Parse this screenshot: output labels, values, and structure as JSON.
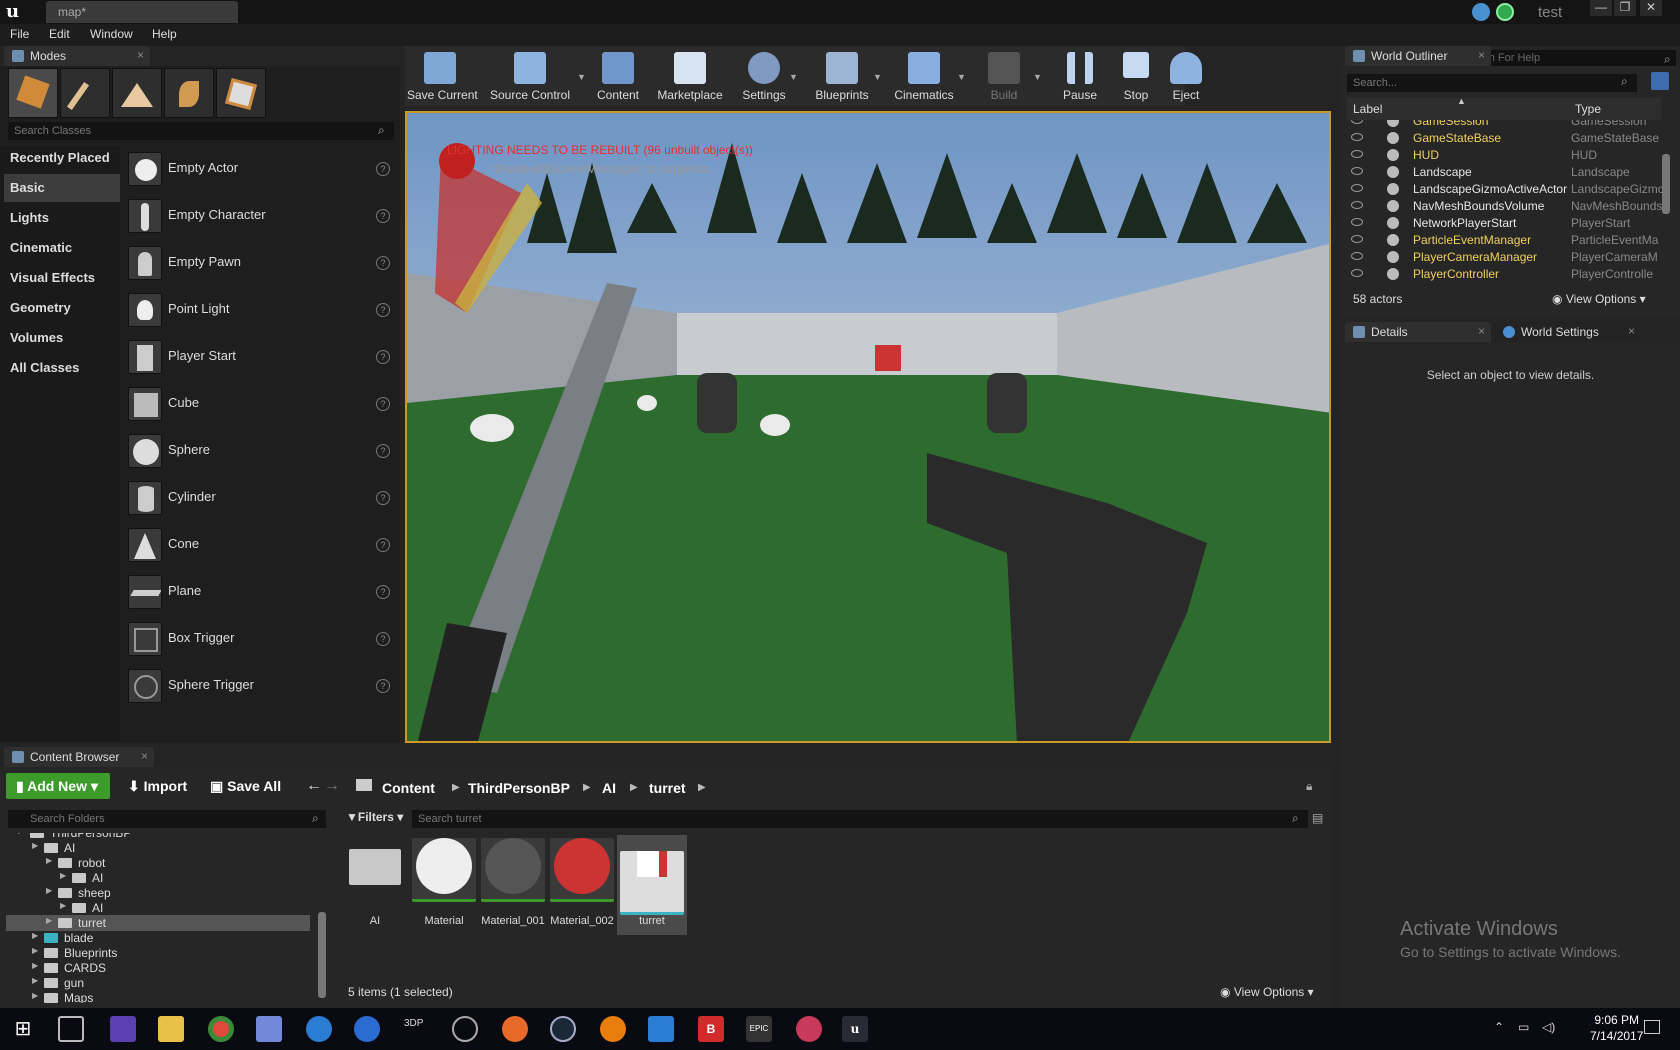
{
  "titlebar": {
    "tab_title": "map*",
    "project_name": "test"
  },
  "menu": {
    "items": [
      "File",
      "Edit",
      "Window",
      "Help"
    ],
    "search_placeholder": "Search For Help"
  },
  "modes": {
    "tab_label": "Modes",
    "search_placeholder": "Search Classes",
    "categories": [
      "Recently Placed",
      "Basic",
      "Lights",
      "Cinematic",
      "Visual Effects",
      "Geometry",
      "Volumes",
      "All Classes"
    ],
    "selected_category": "Basic",
    "items": [
      "Empty Actor",
      "Empty Character",
      "Empty Pawn",
      "Point Light",
      "Player Start",
      "Cube",
      "Sphere",
      "Cylinder",
      "Cone",
      "Plane",
      "Box Trigger",
      "Sphere Trigger"
    ]
  },
  "toolbar": {
    "buttons": [
      "Save Current",
      "Source Control",
      "Content",
      "Marketplace",
      "Settings",
      "Blueprints",
      "Cinematics",
      "Build",
      "Pause",
      "Stop",
      "Eject"
    ],
    "disabled": [
      "Build"
    ]
  },
  "viewport": {
    "warning": "LIGHTING NEEDS TO BE REBUILT (96 unbuilt object(s))",
    "hint": "'DisableAllScreenMessages' to suppress"
  },
  "outliner": {
    "tab_label": "World Outliner",
    "search_placeholder": "Search...",
    "col_label": "Label",
    "col_type": "Type",
    "rows": [
      {
        "label": "GameSession",
        "type": "GameSession",
        "color": "yellow"
      },
      {
        "label": "GameStateBase",
        "type": "GameStateBase",
        "color": "yellow"
      },
      {
        "label": "HUD",
        "type": "HUD",
        "color": "yellow"
      },
      {
        "label": "Landscape",
        "type": "Landscape",
        "color": "white"
      },
      {
        "label": "LandscapeGizmoActiveActor",
        "type": "LandscapeGizmo",
        "color": "white"
      },
      {
        "label": "NavMeshBoundsVolume",
        "type": "NavMeshBounds",
        "color": "white"
      },
      {
        "label": "NetworkPlayerStart",
        "type": "PlayerStart",
        "color": "white"
      },
      {
        "label": "ParticleEventManager",
        "type": "ParticleEventMa",
        "color": "yellow"
      },
      {
        "label": "PlayerCameraManager",
        "type": "PlayerCameraM",
        "color": "yellow"
      },
      {
        "label": "PlayerController",
        "type": "PlayerControlle",
        "color": "yellow"
      }
    ],
    "actor_count": "58 actors",
    "view_options": "View Options"
  },
  "details": {
    "tab_details": "Details",
    "tab_world_settings": "World Settings",
    "empty_message": "Select an object to view details."
  },
  "content_browser": {
    "tab_label": "Content Browser",
    "add_new": "Add New",
    "import": "Import",
    "save_all": "Save All",
    "breadcrumbs": [
      "Content",
      "ThirdPersonBP",
      "AI",
      "turret"
    ],
    "folder_search_placeholder": "Search Folders",
    "filters": "Filters",
    "asset_search_placeholder": "Search turret",
    "tree": [
      {
        "label": "ThirdPersonBP",
        "indent": 1,
        "teal": false
      },
      {
        "label": "AI",
        "indent": 2,
        "teal": false
      },
      {
        "label": "robot",
        "indent": 3,
        "teal": false
      },
      {
        "label": "AI",
        "indent": 4,
        "teal": false
      },
      {
        "label": "sheep",
        "indent": 3,
        "teal": false
      },
      {
        "label": "AI",
        "indent": 4,
        "teal": false
      },
      {
        "label": "turret",
        "indent": 3,
        "teal": false,
        "selected": true
      },
      {
        "label": "blade",
        "indent": 2,
        "teal": true
      },
      {
        "label": "Blueprints",
        "indent": 2,
        "teal": false
      },
      {
        "label": "CARDS",
        "indent": 2,
        "teal": false
      },
      {
        "label": "gun",
        "indent": 2,
        "teal": false
      },
      {
        "label": "Maps",
        "indent": 2,
        "teal": false
      }
    ],
    "assets": [
      "AI",
      "Material",
      "Material_001",
      "Material_002",
      "turret"
    ],
    "status": "5 items (1 selected)",
    "view_options": "View Options"
  },
  "watermark": {
    "title": "Activate Windows",
    "subtitle": "Go to Settings to activate Windows."
  },
  "taskbar": {
    "time": "9:06 PM",
    "date": "7/14/2017",
    "label_3dp": "3DP"
  }
}
